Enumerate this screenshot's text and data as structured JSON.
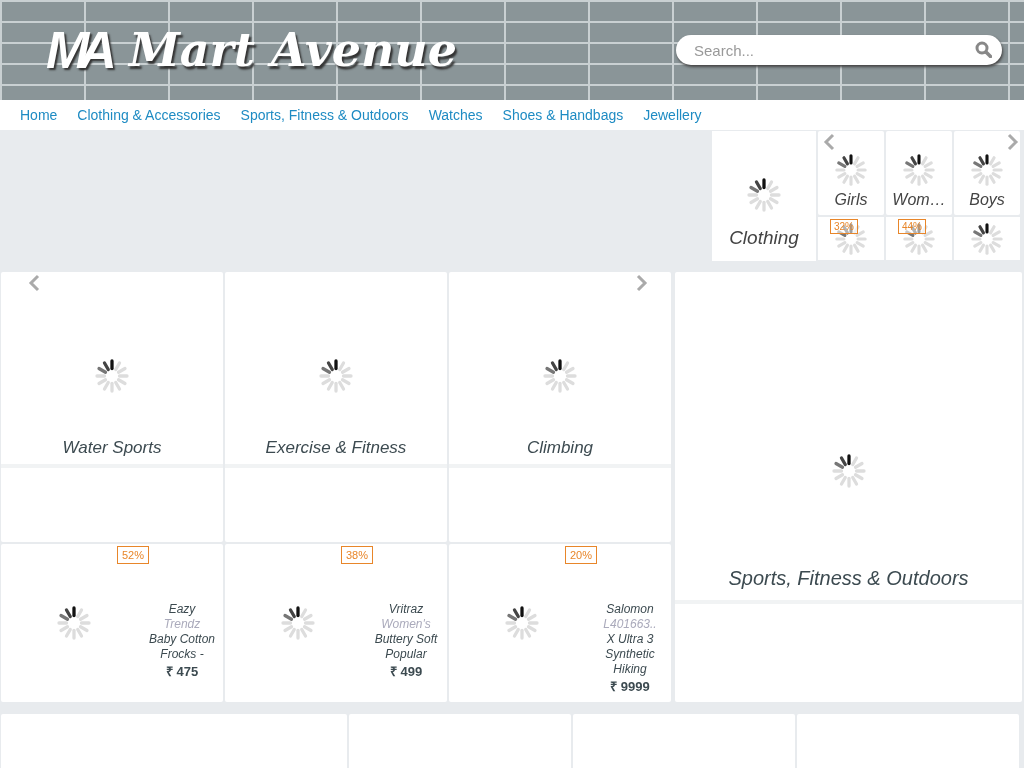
{
  "header": {
    "logo_mark": "MA",
    "logo_text": "Mart Avenue",
    "search": {
      "placeholder": "Search..."
    }
  },
  "nav": [
    "Home",
    "Clothing & Accessories",
    "Sports, Fitness & Outdoors",
    "Watches",
    "Shoes & Handbags",
    "Jewellery"
  ],
  "category_widget": {
    "featured": {
      "label": "Clothing"
    },
    "tiles": [
      {
        "label": "Girls"
      },
      {
        "label": "Wom…"
      },
      {
        "label": "Boys"
      }
    ],
    "deal_tiles": [
      {
        "kind": "deal",
        "badge": "32%"
      },
      {
        "kind": "deal",
        "badge": "44%"
      },
      {
        "kind": "plain"
      }
    ]
  },
  "categories": [
    {
      "label": "Water Sports"
    },
    {
      "label": "Exercise & Fitness"
    },
    {
      "label": "Climbing"
    }
  ],
  "products": [
    {
      "badge": "52%",
      "title": "Eazy",
      "subtitle": "Trendz",
      "description": "Baby Cotton Frocks -",
      "price": "₹ 475"
    },
    {
      "badge": "38%",
      "title": "Vritraz",
      "subtitle": "Women's",
      "description": "Buttery Soft Popular",
      "price": "₹ 499"
    },
    {
      "badge": "20%",
      "title": "Salomon",
      "subtitle": "L401663..",
      "description": "X Ultra 3 Synthetic Hiking",
      "price": "₹ 9999"
    }
  ],
  "featured_category": {
    "label": "Sports, Fitness & Outdoors"
  },
  "bottom_cards": [
    {
      "kind": "wide"
    },
    {
      "kind": "narrow"
    },
    {
      "kind": "narrow"
    },
    {
      "kind": "narrow"
    }
  ]
}
